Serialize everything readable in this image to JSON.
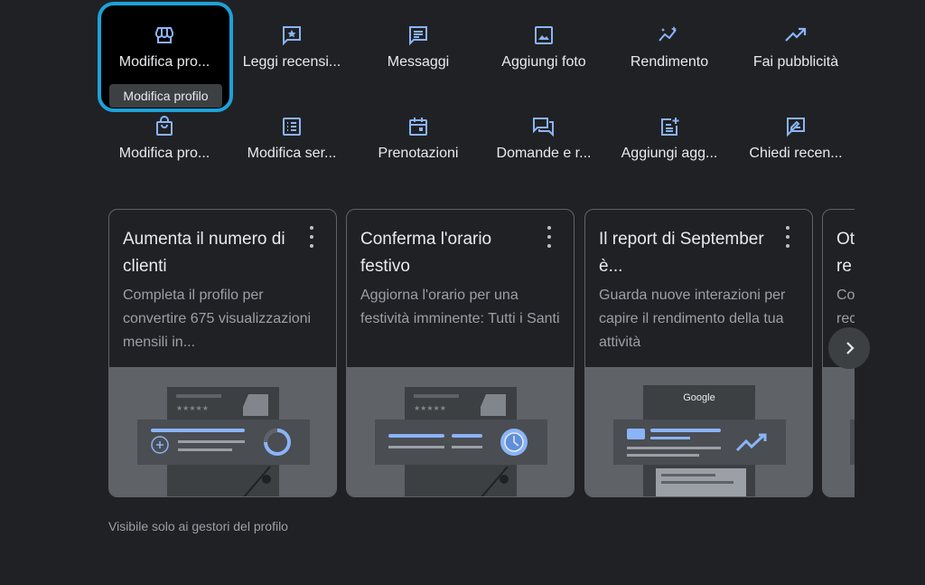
{
  "actions_row1": [
    {
      "label": "Modifica pro...",
      "icon": "storefront-icon"
    },
    {
      "label": "Leggi recensi...",
      "icon": "review-star-icon"
    },
    {
      "label": "Messaggi",
      "icon": "message-icon"
    },
    {
      "label": "Aggiungi foto",
      "icon": "photo-icon"
    },
    {
      "label": "Rendimento",
      "icon": "insights-icon"
    },
    {
      "label": "Fai pubblicità",
      "icon": "trending-up-icon"
    }
  ],
  "actions_row2": [
    {
      "label": "Modifica pro...",
      "icon": "shopping-bag-icon"
    },
    {
      "label": "Modifica ser...",
      "icon": "list-icon"
    },
    {
      "label": "Prenotazioni",
      "icon": "calendar-icon"
    },
    {
      "label": "Domande e r...",
      "icon": "forum-icon"
    },
    {
      "label": "Aggiungi agg...",
      "icon": "post-add-icon"
    },
    {
      "label": "Chiedi recen...",
      "icon": "rate-review-icon"
    }
  ],
  "tooltip": "Modifica profilo",
  "cards": [
    {
      "title": "Aumenta il numero di clienti",
      "desc": "Completa il profilo per convertire 675 visualizzazioni mensili in..."
    },
    {
      "title": "Conferma l'orario festivo",
      "desc": "Aggiorna l'orario per una festività imminente: Tutti i Santi"
    },
    {
      "title": "Il report di September è...",
      "desc": "Guarda nuove interazioni per capire il rendimento della tua attività"
    },
    {
      "title": "Ot re",
      "desc": "Co rec cli"
    }
  ],
  "illustration_google_label": "Google",
  "footer": "Visibile solo ai gestori del profilo",
  "colors": {
    "accent": "#8ab4f8",
    "highlight": "#1da1d8",
    "background": "#202124"
  }
}
